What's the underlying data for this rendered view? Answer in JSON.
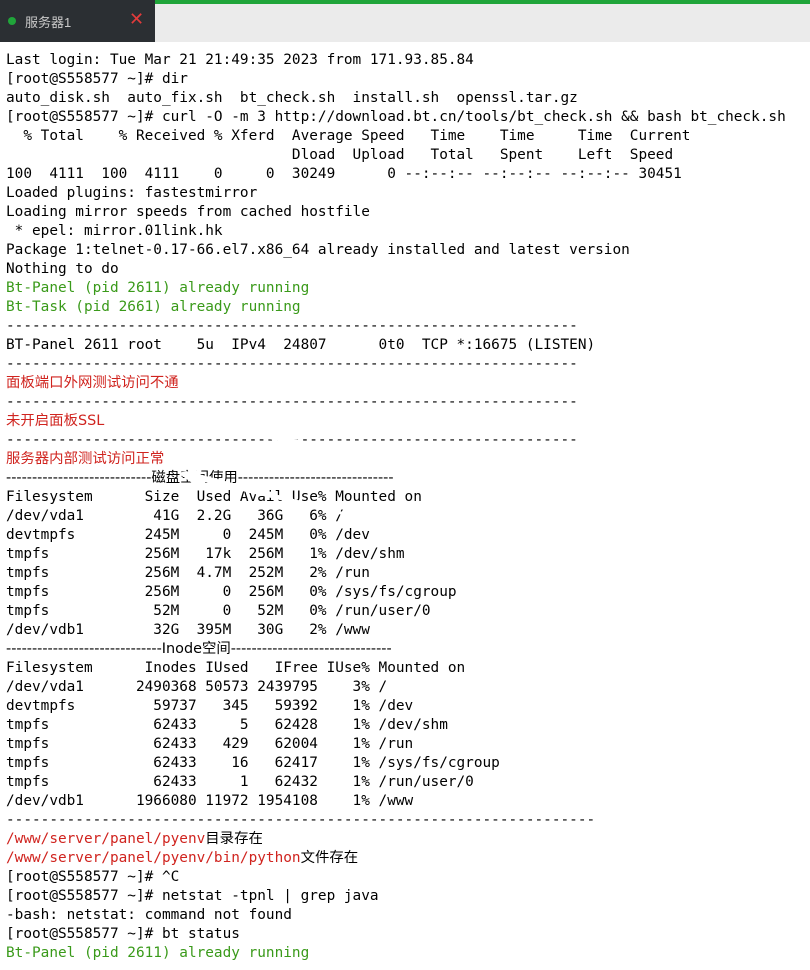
{
  "tab": {
    "label": "服务器1",
    "close_icon": "close-icon"
  },
  "colors": {
    "accent": "#20a53a",
    "green_text": "#3a9a1a",
    "red_text": "#d0241f",
    "tab_bg": "#2b2f33"
  },
  "terminal": {
    "lines": [
      {
        "text": "Last login: Tue Mar 21 21:49:35 2023 from 171.93.85.84",
        "color": "default"
      },
      {
        "text": "[root@S558577 ~]# dir",
        "color": "default"
      },
      {
        "text": "auto_disk.sh  auto_fix.sh  bt_check.sh  install.sh  openssl.tar.gz",
        "color": "default"
      },
      {
        "text": "[root@S558577 ~]# curl -O -m 3 http://download.bt.cn/tools/bt_check.sh && bash bt_check.sh",
        "color": "default"
      },
      {
        "text": "  % Total    % Received % Xferd  Average Speed   Time    Time     Time  Current",
        "color": "default"
      },
      {
        "text": "                                 Dload  Upload   Total   Spent    Left  Speed",
        "color": "default"
      },
      {
        "text": "100  4111  100  4111    0     0  30249      0 --:--:-- --:--:-- --:--:-- 30451",
        "color": "default"
      },
      {
        "text": "Loaded plugins: fastestmirror",
        "color": "default"
      },
      {
        "text": "Loading mirror speeds from cached hostfile",
        "color": "default"
      },
      {
        "text": " * epel: mirror.01link.hk",
        "color": "default"
      },
      {
        "text": "Package 1:telnet-0.17-66.el7.x86_64 already installed and latest version",
        "color": "default"
      },
      {
        "text": "Nothing to do",
        "color": "default"
      },
      {
        "text": "Bt-Panel (pid 2611) already running",
        "color": "green"
      },
      {
        "text": "Bt-Task (pid 2661) already running",
        "color": "green"
      },
      {
        "text": "------------------------------------------------------------------",
        "color": "default"
      },
      {
        "text": "BT-Panel 2611 root    5u  IPv4  24807      0t0  TCP *:16675 (LISTEN)",
        "color": "default"
      },
      {
        "text": "------------------------------------------------------------------",
        "color": "default"
      },
      {
        "text": "面板端口外网测试访问不通",
        "color": "red"
      },
      {
        "text": "------------------------------------------------------------------",
        "color": "default"
      },
      {
        "text": "未开启面板SSL",
        "color": "red"
      },
      {
        "text": "------------------------------------------------------------------",
        "color": "default"
      },
      {
        "text": "服务器内部测试访问正常",
        "color": "red"
      },
      {
        "text": "----------------------------磁盘空间使用------------------------------",
        "color": "default"
      },
      {
        "text": "Filesystem      Size  Used Avail Use% Mounted on",
        "color": "default"
      },
      {
        "text": "/dev/vda1        41G  2.2G   36G   6% /",
        "color": "default"
      },
      {
        "text": "devtmpfs        245M     0  245M   0% /dev",
        "color": "default"
      },
      {
        "text": "tmpfs           256M   17k  256M   1% /dev/shm",
        "color": "default"
      },
      {
        "text": "tmpfs           256M  4.7M  252M   2% /run",
        "color": "default"
      },
      {
        "text": "tmpfs           256M     0  256M   0% /sys/fs/cgroup",
        "color": "default"
      },
      {
        "text": "tmpfs            52M     0   52M   0% /run/user/0",
        "color": "default"
      },
      {
        "text": "/dev/vdb1        32G  395M   30G   2% /www",
        "color": "default"
      },
      {
        "text": "------------------------------Inode空间-------------------------------",
        "color": "default"
      },
      {
        "text": "Filesystem      Inodes IUsed   IFree IUse% Mounted on",
        "color": "default"
      },
      {
        "text": "/dev/vda1      2490368 50573 2439795    3% /",
        "color": "default"
      },
      {
        "text": "devtmpfs         59737   345   59392    1% /dev",
        "color": "default"
      },
      {
        "text": "tmpfs            62433     5   62428    1% /dev/shm",
        "color": "default"
      },
      {
        "text": "tmpfs            62433   429   62004    1% /run",
        "color": "default"
      },
      {
        "text": "tmpfs            62433    16   62417    1% /sys/fs/cgroup",
        "color": "default"
      },
      {
        "text": "tmpfs            62433     1   62432    1% /run/user/0",
        "color": "default"
      },
      {
        "text": "/dev/vdb1      1966080 11972 1954108    1% /www",
        "color": "default"
      },
      {
        "text": "--------------------------------------------------------------------",
        "color": "default"
      },
      {
        "parts": [
          {
            "text": "/www/server/panel/pyenv",
            "color": "red"
          },
          {
            "text": "目录存在",
            "color": "default"
          }
        ]
      },
      {
        "parts": [
          {
            "text": "/www/server/panel/pyenv/bin/python",
            "color": "red"
          },
          {
            "text": "文件存在",
            "color": "default"
          }
        ]
      },
      {
        "text": "[root@S558577 ~]# ^C",
        "color": "default"
      },
      {
        "text": "[root@S558577 ~]# netstat -tpnl | grep java",
        "color": "default"
      },
      {
        "text": "-bash: netstat: command not found",
        "color": "default"
      },
      {
        "text": "[root@S558577 ~]# bt status",
        "color": "default"
      },
      {
        "text": "Bt-Panel (pid 2611) already running",
        "color": "green"
      }
    ]
  }
}
